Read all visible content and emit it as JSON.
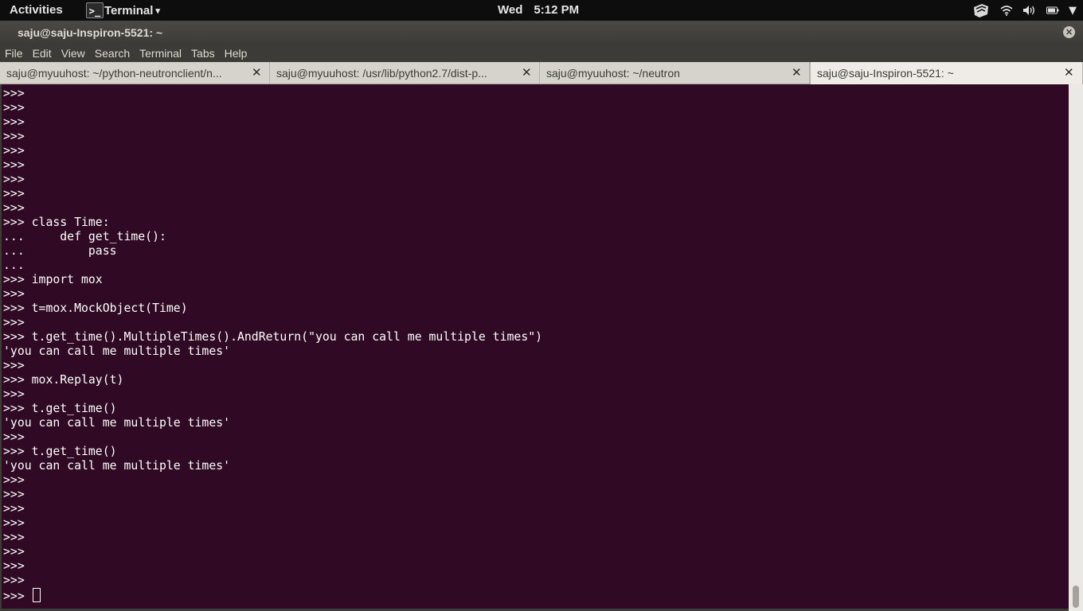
{
  "topbar": {
    "activities": "Activities",
    "app_icon": ">_",
    "app_name": "Terminal",
    "app_arrow": "▾",
    "day": "Wed",
    "time": "5:12 PM",
    "tray": {
      "network_icon": "wifi-icon",
      "volume_icon": "volume-icon",
      "battery_icon": "battery-icon",
      "dropdown": "▼"
    }
  },
  "window": {
    "title": "saju@saju-Inspiron-5521: ~",
    "close_glyph": "×"
  },
  "menu": [
    "File",
    "Edit",
    "View",
    "Search",
    "Terminal",
    "Tabs",
    "Help"
  ],
  "tabs": [
    {
      "label": "saju@myuuhost: ~/python-neutronclient/n...",
      "close": "✕",
      "active": false
    },
    {
      "label": "saju@myuuhost: /usr/lib/python2.7/dist-p...",
      "close": "✕",
      "active": false
    },
    {
      "label": "saju@myuuhost: ~/neutron",
      "close": "✕",
      "active": false
    },
    {
      "label": "saju@saju-Inspiron-5521: ~",
      "close": "✕",
      "active": true
    }
  ],
  "terminal": {
    "lines": [
      ">>>",
      ">>>",
      ">>>",
      ">>>",
      ">>>",
      ">>>",
      ">>>",
      ">>>",
      ">>>",
      ">>> class Time:",
      "...     def get_time():",
      "...         pass",
      "...",
      ">>> import mox",
      ">>>",
      ">>> t=mox.MockObject(Time)",
      ">>>",
      ">>> t.get_time().MultipleTimes().AndReturn(\"you can call me multiple times\")",
      "'you can call me multiple times'",
      ">>>",
      ">>> mox.Replay(t)",
      ">>>",
      ">>> t.get_time()",
      "'you can call me multiple times'",
      ">>>",
      ">>> t.get_time()",
      "'you can call me multiple times'",
      ">>>",
      ">>>",
      ">>>",
      ">>>",
      ">>>",
      ">>>",
      ">>>",
      ">>>"
    ],
    "prompt_line": ">>> "
  },
  "colors": {
    "terminal_bg": "#300a24",
    "terminal_fg": "#ffffff",
    "topbar_bg": "#0d0d0d",
    "titlebar_bg": "#3c3b37"
  }
}
